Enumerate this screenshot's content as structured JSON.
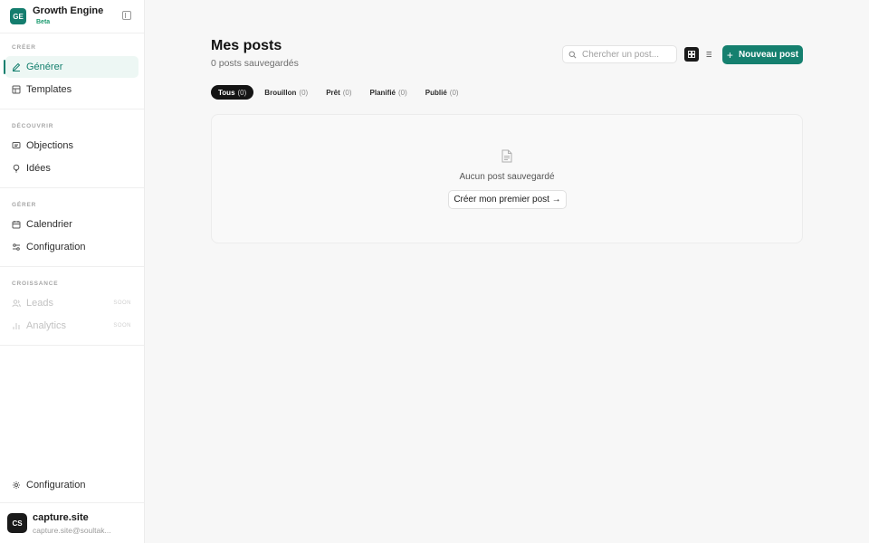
{
  "brand": {
    "logo": "GE",
    "name": "Growth Engine",
    "badge": "Beta"
  },
  "sidebar": {
    "sections": [
      {
        "title": "CRÉER",
        "items": [
          {
            "label": "Générer",
            "icon": "pencil-icon",
            "active": true
          },
          {
            "label": "Templates",
            "icon": "layout-icon"
          }
        ]
      },
      {
        "title": "DÉCOUVRIR",
        "items": [
          {
            "label": "Objections",
            "icon": "message-icon"
          },
          {
            "label": "Idées",
            "icon": "lightbulb-icon"
          }
        ]
      },
      {
        "title": "GÉRER",
        "items": [
          {
            "label": "Calendrier",
            "icon": "calendar-icon"
          },
          {
            "label": "Configuration",
            "icon": "sliders-icon"
          }
        ]
      },
      {
        "title": "CROISSANCE",
        "items": [
          {
            "label": "Leads",
            "icon": "users-icon",
            "badge": "SOON",
            "disabled": true
          },
          {
            "label": "Analytics",
            "icon": "chart-icon",
            "badge": "SOON",
            "disabled": true
          }
        ]
      }
    ],
    "bottom": {
      "label": "Configuration",
      "icon": "gear-icon"
    },
    "user": {
      "initials": "CS",
      "name": "capture.site",
      "email": "capture.site@soultak..."
    }
  },
  "main": {
    "title": "Mes posts",
    "subtitle": "0 posts sauvegardés",
    "search_placeholder": "Chercher un post...",
    "new_button": "Nouveau post",
    "tabs": [
      {
        "label": "Tous",
        "count": "(0)",
        "active": true
      },
      {
        "label": "Brouillon",
        "count": "(0)"
      },
      {
        "label": "Prêt",
        "count": "(0)"
      },
      {
        "label": "Planifié",
        "count": "(0)"
      },
      {
        "label": "Publié",
        "count": "(0)"
      }
    ],
    "empty": {
      "message": "Aucun post sauvegardé",
      "cta": "Créer mon premier post →"
    }
  },
  "colors": {
    "accent": "#15806f",
    "active_bg": "#edf7f4",
    "dark": "#141414"
  }
}
